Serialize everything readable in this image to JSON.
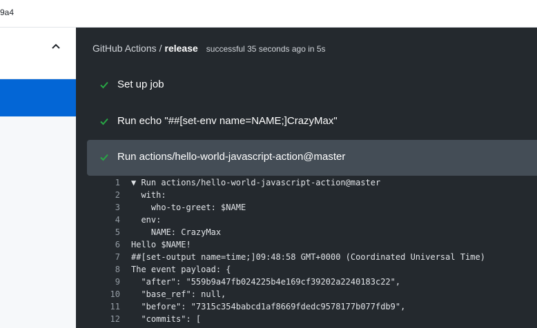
{
  "top": {
    "sha_fragment": "9a4"
  },
  "breadcrumb": {
    "owner": "GitHub Actions",
    "separator": "/",
    "workflow": "release",
    "status": "successful 35 seconds ago in 5s"
  },
  "steps": [
    {
      "label": "Set up job",
      "icon": "check-icon",
      "status": "success"
    },
    {
      "label": "Run echo \"##[set-env name=NAME;]CrazyMax\"",
      "icon": "check-icon",
      "status": "success"
    },
    {
      "label": "Run actions/hello-world-javascript-action@master",
      "icon": "check-icon",
      "status": "success",
      "expanded": true
    }
  ],
  "log": [
    {
      "n": "1",
      "text": "▼ Run actions/hello-world-javascript-action@master"
    },
    {
      "n": "2",
      "text": "  with:"
    },
    {
      "n": "3",
      "text": "    who-to-greet: $NAME"
    },
    {
      "n": "4",
      "text": "  env:"
    },
    {
      "n": "5",
      "text": "    NAME: CrazyMax"
    },
    {
      "n": "6",
      "text": "Hello $NAME!"
    },
    {
      "n": "7",
      "text": "##[set-output name=time;]09:48:58 GMT+0000 (Coordinated Universal Time)"
    },
    {
      "n": "8",
      "text": "The event payload: {"
    },
    {
      "n": "9",
      "text": "  \"after\": \"559b9a47fb024225b4e169cf39202a2240183c22\","
    },
    {
      "n": "10",
      "text": "  \"base_ref\": null,"
    },
    {
      "n": "11",
      "text": "  \"before\": \"7315c354babcd1af8669fdedc9578177b077fdb9\","
    },
    {
      "n": "12",
      "text": "  \"commits\": ["
    }
  ],
  "colors": {
    "accent": "#0366d6",
    "success": "#28a745",
    "panel": "#24292e",
    "active_step": "#444d56"
  }
}
